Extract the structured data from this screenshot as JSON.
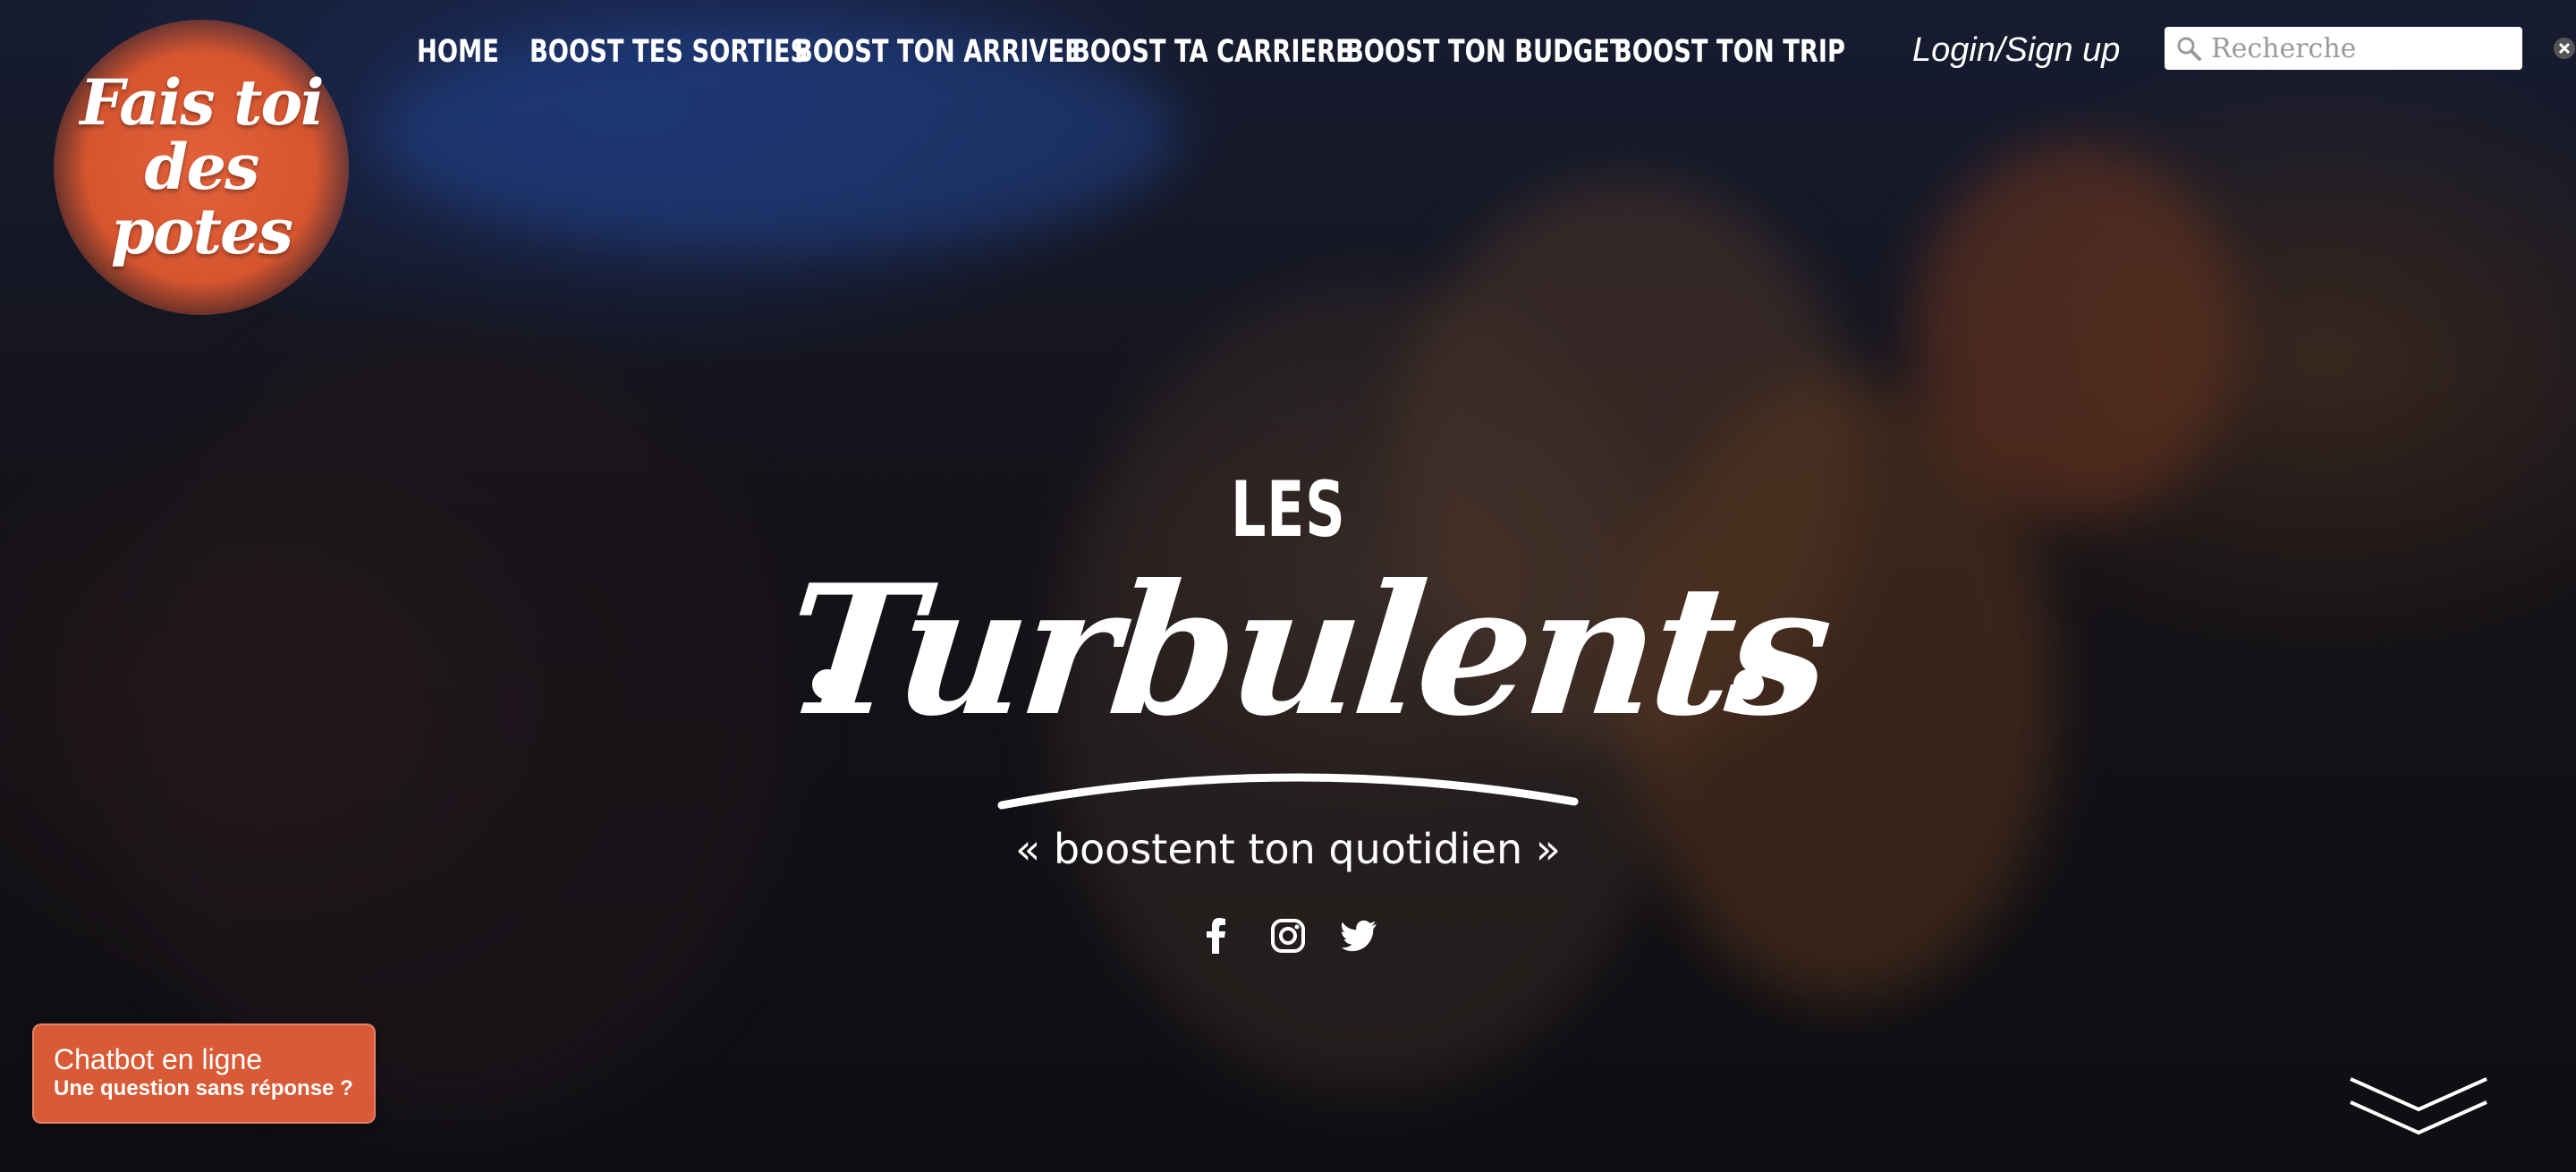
{
  "logo": {
    "line1": "Fais toi",
    "line2": "des potes"
  },
  "nav": {
    "items": [
      {
        "label": "HOME"
      },
      {
        "label": "BOOST TES SORTIES"
      },
      {
        "label": "BOOST TON ARRIVEE"
      },
      {
        "label": "BOOST TA CARRIERE"
      },
      {
        "label": "BOOST TON BUDGET"
      },
      {
        "label": "BOOST TON TRIP"
      }
    ],
    "login_label": "Login/Sign up"
  },
  "search": {
    "placeholder": "Recherche",
    "icon": "magnifier-icon",
    "clear_icon": "clear-icon"
  },
  "hero": {
    "brand_small": "LES",
    "brand_large": "Turbulents",
    "tagline": "« boostent ton quotidien »",
    "social": [
      "facebook-icon",
      "instagram-icon",
      "twitter-icon"
    ]
  },
  "chatbot": {
    "title": "Chatbot en ligne",
    "subtitle": "Une question sans réponse ?"
  },
  "colors": {
    "accent": "#d85a36",
    "text": "#ffffff"
  }
}
